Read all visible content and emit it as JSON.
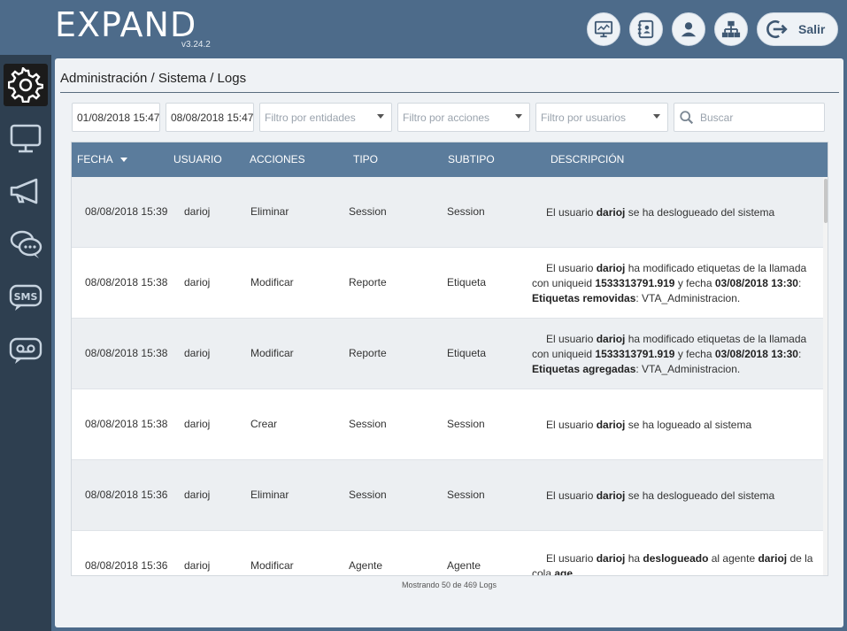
{
  "header": {
    "logo": "EXPAND",
    "version": "v3.24.2",
    "exit_label": "Salir"
  },
  "top_buttons": [
    {
      "name": "dashboard-icon"
    },
    {
      "name": "contacts-icon"
    },
    {
      "name": "user-icon"
    },
    {
      "name": "hierarchy-icon"
    }
  ],
  "sidebar": {
    "items": [
      {
        "name": "gear-icon",
        "active": true
      },
      {
        "name": "monitor-icon",
        "active": false
      },
      {
        "name": "megaphone-icon",
        "active": false
      },
      {
        "name": "chat-icon",
        "active": false
      },
      {
        "name": "sms-icon",
        "label": "SMS",
        "active": false
      },
      {
        "name": "voicemail-icon",
        "active": false
      }
    ]
  },
  "breadcrumb": "Administración / Sistema / Logs",
  "filters": {
    "date_from": "01/08/2018 15:47",
    "date_to": "08/08/2018 15:47",
    "entities_placeholder": "Filtro por entidades",
    "actions_placeholder": "Filtro por acciones",
    "users_placeholder": "Filtro por usuarios",
    "search_placeholder": "Buscar"
  },
  "table": {
    "columns": [
      "FECHA",
      "USUARIO",
      "ACCIONES",
      "TIPO",
      "SUBTIPO",
      "DESCRIPCIÓN"
    ],
    "rows": [
      {
        "fecha": "08/08/2018 15:39",
        "usuario": "darioj",
        "accion": "Eliminar",
        "tipo": "Session",
        "subtipo": "Session",
        "desc": [
          {
            "t": "El usuario ",
            "b": false
          },
          {
            "t": "darioj",
            "b": true
          },
          {
            "t": " se ha deslogueado del sistema",
            "b": false
          }
        ]
      },
      {
        "fecha": "08/08/2018 15:38",
        "usuario": "darioj",
        "accion": "Modificar",
        "tipo": "Reporte",
        "subtipo": "Etiqueta",
        "desc": [
          {
            "t": "El usuario ",
            "b": false
          },
          {
            "t": "darioj",
            "b": true
          },
          {
            "t": " ha modificado etiquetas de la llamada con uniqueid ",
            "b": false
          },
          {
            "t": "1533313791.919",
            "b": true
          },
          {
            "t": " y fecha ",
            "b": false
          },
          {
            "t": "03/08/2018 13:30",
            "b": true
          },
          {
            "t": ": ",
            "b": false
          },
          {
            "t": "Etiquetas removidas",
            "b": true
          },
          {
            "t": ": VTA_Administracion.",
            "b": false
          }
        ]
      },
      {
        "fecha": "08/08/2018 15:38",
        "usuario": "darioj",
        "accion": "Modificar",
        "tipo": "Reporte",
        "subtipo": "Etiqueta",
        "desc": [
          {
            "t": "El usuario ",
            "b": false
          },
          {
            "t": "darioj",
            "b": true
          },
          {
            "t": " ha modificado etiquetas de la llamada con uniqueid ",
            "b": false
          },
          {
            "t": "1533313791.919",
            "b": true
          },
          {
            "t": " y fecha ",
            "b": false
          },
          {
            "t": "03/08/2018 13:30",
            "b": true
          },
          {
            "t": ": ",
            "b": false
          },
          {
            "t": "Etiquetas agregadas",
            "b": true
          },
          {
            "t": ": VTA_Administracion.",
            "b": false
          }
        ]
      },
      {
        "fecha": "08/08/2018 15:38",
        "usuario": "darioj",
        "accion": "Crear",
        "tipo": "Session",
        "subtipo": "Session",
        "desc": [
          {
            "t": "El usuario ",
            "b": false
          },
          {
            "t": "darioj",
            "b": true
          },
          {
            "t": " se ha logueado al sistema",
            "b": false
          }
        ]
      },
      {
        "fecha": "08/08/2018 15:36",
        "usuario": "darioj",
        "accion": "Eliminar",
        "tipo": "Session",
        "subtipo": "Session",
        "desc": [
          {
            "t": "El usuario ",
            "b": false
          },
          {
            "t": "darioj",
            "b": true
          },
          {
            "t": " se ha deslogueado del sistema",
            "b": false
          }
        ]
      },
      {
        "fecha": "08/08/2018 15:36",
        "usuario": "darioj",
        "accion": "Modificar",
        "tipo": "Agente",
        "subtipo": "Agente",
        "desc": [
          {
            "t": "El usuario ",
            "b": false
          },
          {
            "t": "darioj",
            "b": true
          },
          {
            "t": " ha ",
            "b": false
          },
          {
            "t": "deslogueado",
            "b": true
          },
          {
            "t": " al agente ",
            "b": false
          },
          {
            "t": "darioj",
            "b": true
          },
          {
            "t": " de la cola ",
            "b": false
          },
          {
            "t": "age",
            "b": true
          }
        ]
      }
    ]
  },
  "footer_info": "Mostrando 50 de 469 Logs",
  "colors": {
    "header_bg": "#4d6b8a",
    "sidebar_bg": "#2e3f50",
    "table_header_bg": "#5b7c9c",
    "logo_accent": "#2bc0b4"
  }
}
